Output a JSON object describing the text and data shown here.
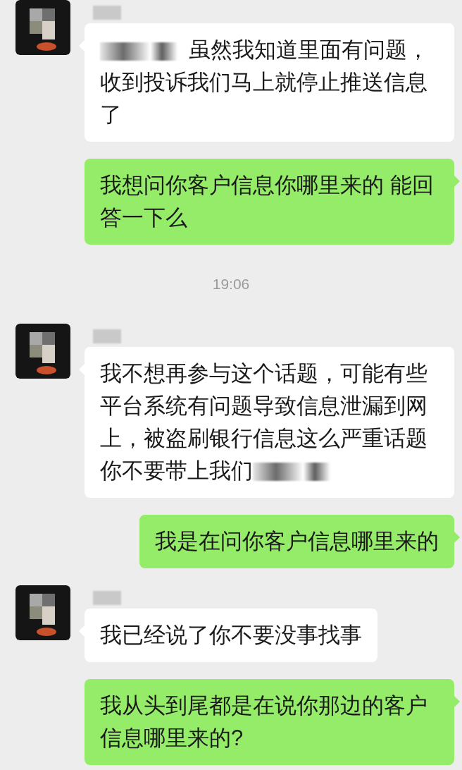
{
  "messages": [
    {
      "kind": "received",
      "redacted_prefix": true,
      "redacted_suffix": false,
      "text": "虽然我知道里面有问题，收到投诉我们马上就停止推送信息了"
    },
    {
      "kind": "sent",
      "text": "我想问你客户信息你哪里来的 能回答一下么"
    },
    {
      "kind": "time",
      "text": "19:06"
    },
    {
      "kind": "received",
      "redacted_prefix": false,
      "redacted_suffix": true,
      "text": "我不想再参与这个话题，可能有些平台系统有问题导致信息泄漏到网上，被盗刷银行信息这么严重话题你不要带上我们"
    },
    {
      "kind": "sent",
      "text": "我是在问你客户信息哪里来的"
    },
    {
      "kind": "received",
      "redacted_prefix": false,
      "redacted_suffix": false,
      "text": "我已经说了你不要没事找事"
    },
    {
      "kind": "sent",
      "text": "我从头到尾都是在说你那边的客户信息哪里来的?"
    }
  ]
}
